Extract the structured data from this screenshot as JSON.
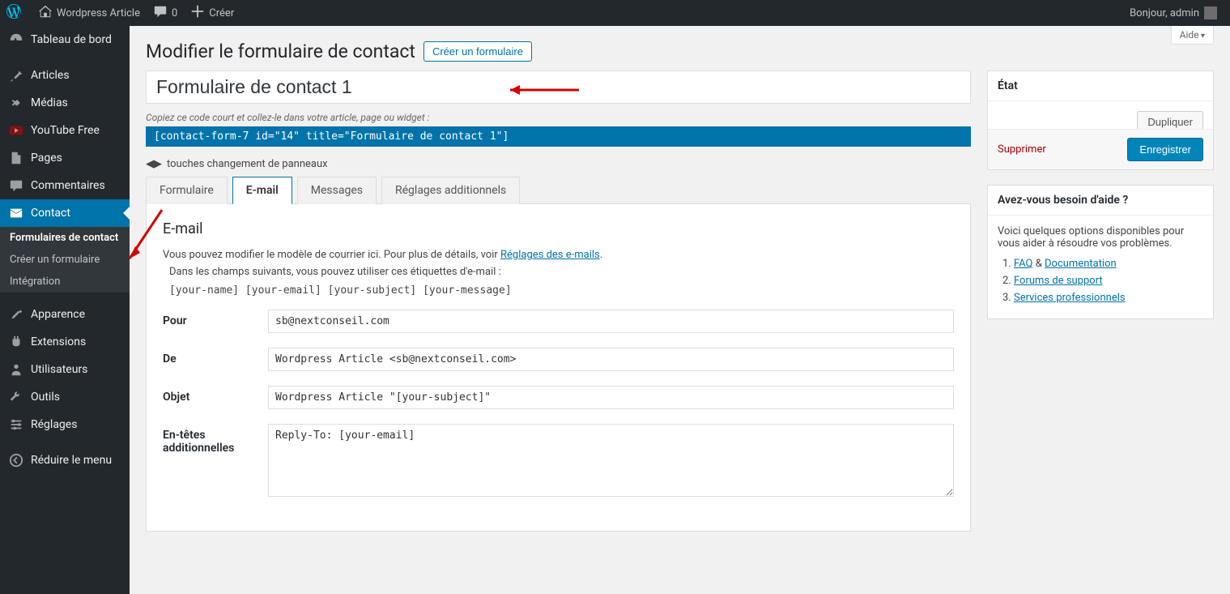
{
  "adminbar": {
    "site_name": "Wordpress Article",
    "comments": "0",
    "create": "Créer",
    "greeting": "Bonjour, admin"
  },
  "sidebar": {
    "dashboard": "Tableau de bord",
    "posts": "Articles",
    "media": "Médias",
    "youtube": "YouTube Free",
    "pages": "Pages",
    "comments": "Commentaires",
    "contact": "Contact",
    "contact_sub1": "Formulaires de contact",
    "contact_sub2": "Créer un formulaire",
    "contact_sub3": "Intégration",
    "appearance": "Apparence",
    "plugins": "Extensions",
    "users": "Utilisateurs",
    "tools": "Outils",
    "settings": "Réglages",
    "collapse": "Réduire le menu"
  },
  "help_tab": "Aide",
  "page_title": "Modifier le formulaire de contact",
  "add_new": "Créer un formulaire",
  "form_title": "Formulaire de contact 1",
  "copy_hint": "Copiez ce code court et collez-le dans votre article, page ou widget :",
  "shortcode": "[contact-form-7 id=\"14\" title=\"Formulaire de contact 1\"]",
  "panel_switch": "touches changement de panneaux",
  "tabs": {
    "form": "Formulaire",
    "email": "E-mail",
    "messages": "Messages",
    "additional": "Réglages additionnels"
  },
  "email_panel": {
    "heading": "E-mail",
    "desc1": "Vous pouvez modifier le modèle de courrier ici. Pour plus de détails, voir ",
    "desc1_link": "Réglages des e-mails",
    "desc2": "Dans les champs suivants, vous pouvez utiliser ces étiquettes d'e-mail :",
    "tags": "[your-name] [your-email] [your-subject] [your-message]",
    "to_label": "Pour",
    "to_value": "sb@nextconseil.com",
    "from_label": "De",
    "from_value": "Wordpress Article <sb@nextconseil.com>",
    "subject_label": "Objet",
    "subject_value": "Wordpress Article \"[your-subject]\"",
    "headers_label": "En-têtes additionnelles",
    "headers_value": "Reply-To: [your-email]"
  },
  "status_box": {
    "title": "État",
    "duplicate": "Dupliquer",
    "delete": "Supprimer",
    "save": "Enregistrer"
  },
  "help_box": {
    "title": "Avez-vous besoin d'aide ?",
    "intro": "Voici quelques options disponibles pour vous aider à résoudre vos problèmes.",
    "faq": "FAQ",
    "and": " & ",
    "docs": "Documentation",
    "forums": "Forums de support",
    "services": "Services professionnels"
  }
}
